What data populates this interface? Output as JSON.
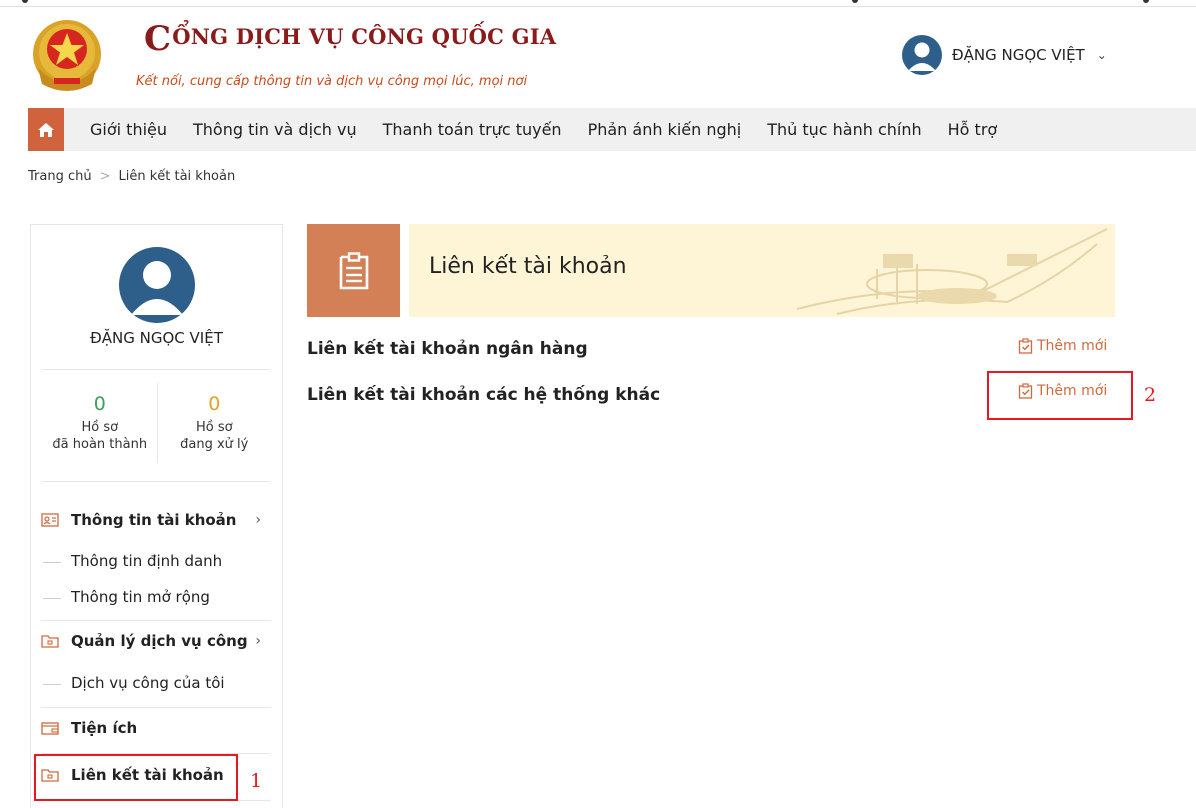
{
  "header": {
    "brand_initial": "C",
    "brand_title_rest": "ỔNG DỊCH VỤ CÔNG QUỐC GIA",
    "brand_subtitle": "Kết nối, cung cấp thông tin và dịch vụ công mọi lúc, mọi nơi",
    "user_name": "ĐẶNG NGỌC VIỆT",
    "user_chevron": "⌄"
  },
  "nav": {
    "items": [
      "Giới thiệu",
      "Thông tin và dịch vụ",
      "Thanh toán trực tuyến",
      "Phản ánh kiến nghị",
      "Thủ tục hành chính",
      "Hỗ trợ"
    ]
  },
  "breadcrumb": {
    "home": "Trang chủ",
    "separator": ">",
    "current": "Liên kết tài khoản"
  },
  "sidebar": {
    "user_name": "ĐẶNG NGỌC VIỆT",
    "stats": [
      {
        "value": "0",
        "label": "Hồ sơ\nđã hoàn thành"
      },
      {
        "value": "0",
        "label": "Hồ sơ\nđang xử lý"
      }
    ],
    "menu": [
      {
        "label": "Thông tin tài khoản",
        "icon": "id-card-icon",
        "arrow": "›"
      },
      {
        "label": "Thông tin định danh",
        "sub": true
      },
      {
        "label": "Thông tin mở rộng",
        "sub": true
      },
      {
        "label": "Quản lý dịch vụ công",
        "icon": "folder-icon",
        "arrow": "›"
      },
      {
        "label": "Dịch vụ công của tôi",
        "sub": true
      },
      {
        "label": "Tiện ích",
        "icon": "wallet-icon"
      },
      {
        "label": "Liên kết tài khoản",
        "icon": "folder-icon"
      }
    ]
  },
  "main": {
    "banner_title": "Liên kết tài khoản",
    "rows": [
      {
        "title": "Liên kết tài khoản ngân hàng",
        "action": "Thêm mới"
      },
      {
        "title": "Liên kết tài khoản các hệ thống khác",
        "action": "Thêm mới"
      }
    ]
  },
  "annotations": {
    "label_1": "1",
    "label_2": "2",
    "color": "#e31c23"
  },
  "colors": {
    "brand_red": "#8b1a1a",
    "accent_orange": "#d0633d",
    "link_orange": "#cf6a3c",
    "done_green": "#3aa25b",
    "processing_amber": "#e5a226",
    "avatar_blue": "#2e5f8a"
  }
}
